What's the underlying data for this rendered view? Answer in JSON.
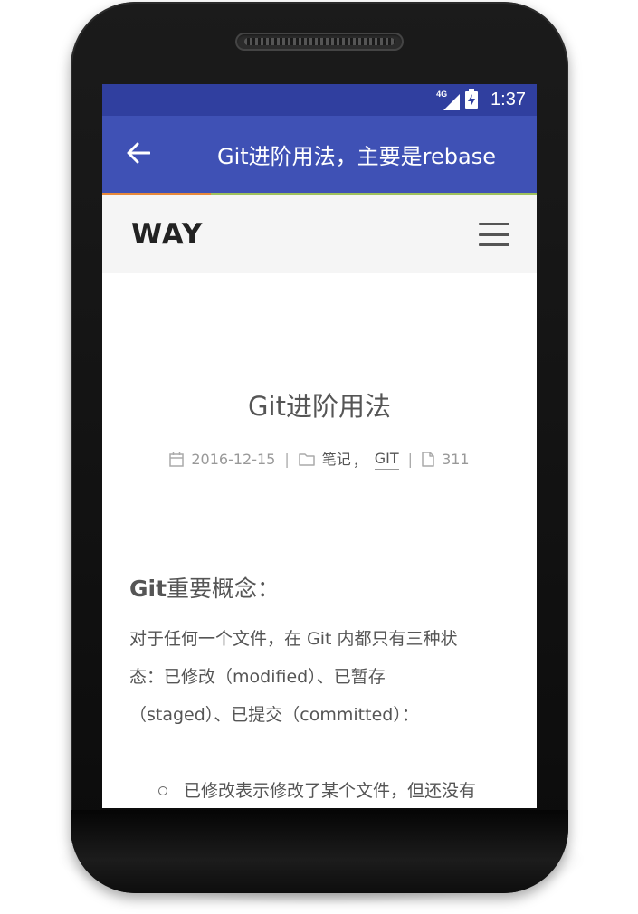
{
  "status_bar": {
    "network": "4G",
    "time": "1:37"
  },
  "app_bar": {
    "title": "Git进阶用法，主要是rebase"
  },
  "site": {
    "logo": "WAY"
  },
  "post": {
    "title": "Git进阶用法",
    "date": "2016-12-15",
    "separator": "|",
    "categories": [
      "笔记",
      "GIT"
    ],
    "category_comma": "，",
    "word_count": "311",
    "section_title_bold": "Git",
    "section_title_rest": "重要概念：",
    "paragraph_lines": [
      "对于任何一个文件，在 Git 内都只有三种状",
      "态：已修改（modified）、已暂存",
      "（staged）、已提交（committed）："
    ],
    "list_items": [
      "已修改表示修改了某个文件，但还没有"
    ]
  },
  "colors": {
    "status_bar": "#303f9f",
    "app_bar": "#3f51b5",
    "progress_orange": "#e8893a",
    "progress_green": "#9fc15c"
  }
}
